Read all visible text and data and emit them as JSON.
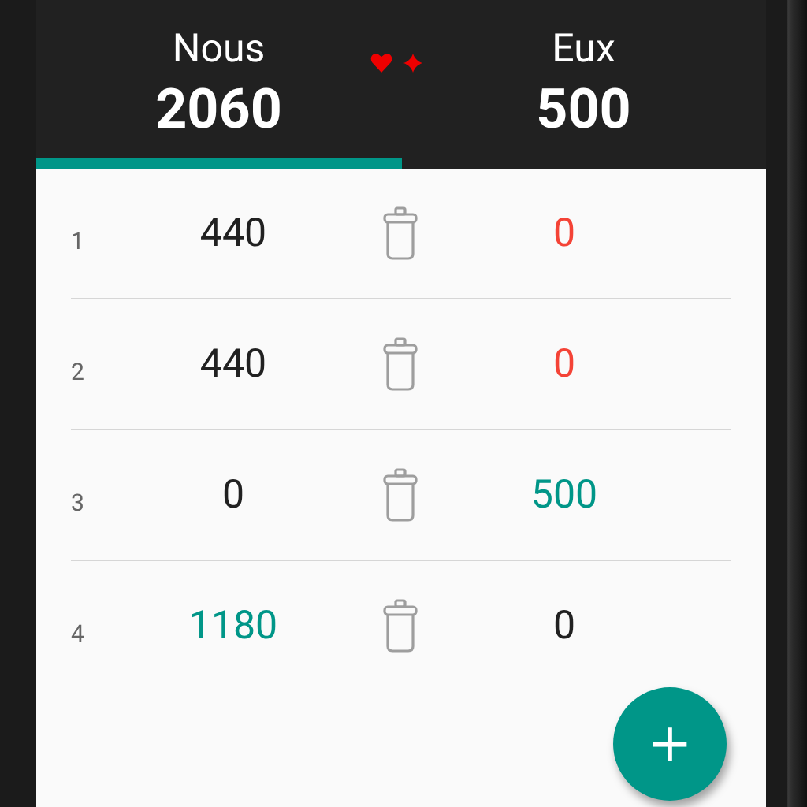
{
  "tabs": [
    {
      "label": "Nous",
      "score": "2060",
      "selected": true
    },
    {
      "label": "Eux",
      "score": "500",
      "selected": false
    }
  ],
  "rounds": [
    {
      "number": "1",
      "we": {
        "value": "440",
        "color": "#212121"
      },
      "they": {
        "value": "0",
        "color": "#f44336"
      }
    },
    {
      "number": "2",
      "we": {
        "value": "440",
        "color": "#212121"
      },
      "they": {
        "value": "0",
        "color": "#f44336"
      }
    },
    {
      "number": "3",
      "we": {
        "value": "0",
        "color": "#212121"
      },
      "they": {
        "value": "500",
        "color": "#009688"
      }
    },
    {
      "number": "4",
      "we": {
        "value": "1180",
        "color": "#009688"
      },
      "they": {
        "value": "0",
        "color": "#212121"
      }
    }
  ],
  "fab": {
    "label": "+"
  }
}
